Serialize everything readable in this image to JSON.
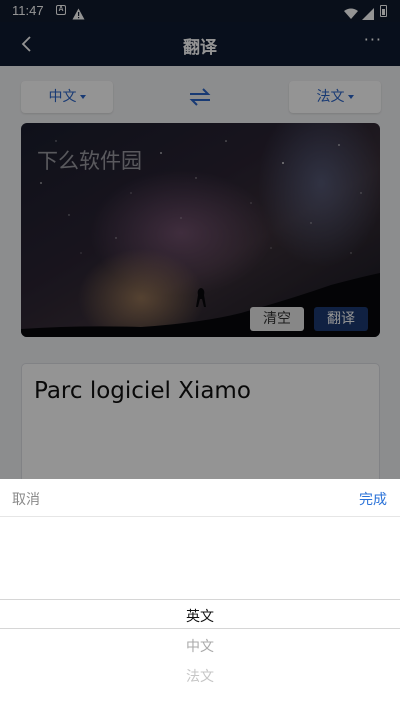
{
  "status_bar": {
    "time": "11:47"
  },
  "title_bar": {
    "title": "翻译",
    "more_label": "···"
  },
  "lang_bar": {
    "source": "中文",
    "target": "法文"
  },
  "input": {
    "text": "下么软件园",
    "clear_label": "清空",
    "translate_label": "翻译"
  },
  "output": {
    "text": "Parc logiciel Xiamo"
  },
  "picker": {
    "cancel_label": "取消",
    "done_label": "完成",
    "options": [
      "英文",
      "中文",
      "法文"
    ],
    "selected": "英文"
  },
  "colors": {
    "accent": "#2a64c9",
    "header": "#0f1b31",
    "primary_button": "#1d3a72"
  }
}
